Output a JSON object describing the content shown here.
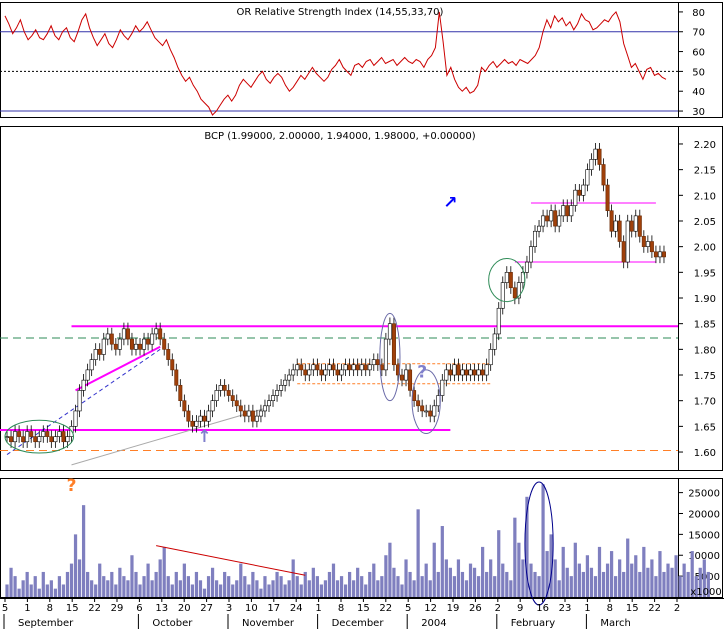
{
  "chart_data": [
    {
      "panel": "indicator",
      "type": "line",
      "title": "OR Relative Strength Index (14,55,33,70)",
      "yticks": [
        30,
        40,
        50,
        60,
        70,
        80
      ],
      "ylim": [
        27,
        85
      ],
      "guides": [
        {
          "y": 70,
          "style": "solid",
          "color": "#3333aa"
        },
        {
          "y": 50,
          "style": "dotted",
          "color": "#000000"
        },
        {
          "y": 30,
          "style": "solid",
          "color": "#3333aa"
        }
      ],
      "series": [
        {
          "color": "#cc0000",
          "values": [
            78,
            74,
            69,
            72,
            76,
            70,
            66,
            68,
            71,
            67,
            66,
            69,
            73,
            68,
            66,
            70,
            72,
            67,
            65,
            70,
            76,
            79,
            72,
            67,
            63,
            66,
            69,
            64,
            62,
            66,
            71,
            68,
            66,
            69,
            73,
            70,
            72,
            75,
            71,
            67,
            65,
            63,
            66,
            61,
            57,
            52,
            48,
            45,
            47,
            43,
            40,
            36,
            34,
            32,
            28,
            30,
            33,
            36,
            38,
            35,
            38,
            43,
            46,
            44,
            42,
            45,
            48,
            50,
            46,
            44,
            47,
            49,
            47,
            43,
            40,
            42,
            45,
            48,
            46,
            49,
            52,
            49,
            47,
            45,
            47,
            51,
            53,
            56,
            52,
            50,
            48,
            53,
            54,
            52,
            55,
            56,
            53,
            55,
            57,
            54,
            55,
            56,
            53,
            55,
            57,
            55,
            54,
            56,
            55,
            52,
            56,
            58,
            62,
            80,
            65,
            48,
            52,
            46,
            42,
            40,
            42,
            39,
            40,
            43,
            52,
            50,
            53,
            55,
            52,
            54,
            56,
            54,
            55,
            53,
            56,
            55,
            54,
            56,
            58,
            62,
            70,
            76,
            72,
            78,
            75,
            77,
            73,
            75,
            71,
            74,
            79,
            76,
            75,
            71,
            72,
            74,
            76,
            75,
            78,
            80,
            75,
            64,
            58,
            52,
            54,
            50,
            46,
            51,
            52,
            48,
            49,
            47,
            46
          ]
        }
      ]
    },
    {
      "panel": "price",
      "type": "candlestick",
      "title": "BCP (1.99000, 2.00000, 1.94000, 1.98000, +0.00000)",
      "yticks": [
        "1.60",
        "1.65",
        "1.70",
        "1.75",
        "1.80",
        "1.85",
        "1.90",
        "1.95",
        "2.00",
        "2.05",
        "2.10",
        "2.15",
        "2.20"
      ],
      "ylim": [
        1.565,
        2.235
      ],
      "close": [
        1.63,
        1.62,
        1.64,
        1.63,
        1.62,
        1.64,
        1.63,
        1.62,
        1.63,
        1.64,
        1.63,
        1.62,
        1.63,
        1.64,
        1.62,
        1.63,
        1.65,
        1.68,
        1.72,
        1.74,
        1.76,
        1.78,
        1.8,
        1.79,
        1.82,
        1.83,
        1.81,
        1.8,
        1.82,
        1.84,
        1.82,
        1.8,
        1.81,
        1.8,
        1.82,
        1.81,
        1.83,
        1.84,
        1.82,
        1.8,
        1.78,
        1.76,
        1.73,
        1.7,
        1.68,
        1.66,
        1.65,
        1.66,
        1.67,
        1.66,
        1.68,
        1.7,
        1.72,
        1.73,
        1.72,
        1.71,
        1.7,
        1.69,
        1.68,
        1.67,
        1.68,
        1.66,
        1.67,
        1.68,
        1.69,
        1.7,
        1.71,
        1.72,
        1.73,
        1.74,
        1.75,
        1.76,
        1.77,
        1.76,
        1.75,
        1.76,
        1.77,
        1.76,
        1.75,
        1.76,
        1.77,
        1.76,
        1.75,
        1.76,
        1.77,
        1.76,
        1.77,
        1.76,
        1.77,
        1.76,
        1.77,
        1.78,
        1.77,
        1.76,
        1.82,
        1.85,
        1.77,
        1.75,
        1.74,
        1.76,
        1.72,
        1.7,
        1.69,
        1.68,
        1.68,
        1.67,
        1.69,
        1.71,
        1.74,
        1.76,
        1.75,
        1.77,
        1.75,
        1.76,
        1.75,
        1.76,
        1.75,
        1.76,
        1.75,
        1.77,
        1.8,
        1.83,
        1.88,
        1.93,
        1.95,
        1.92,
        1.9,
        1.93,
        1.95,
        1.97,
        2.0,
        2.03,
        2.04,
        2.06,
        2.05,
        2.07,
        2.04,
        2.06,
        2.08,
        2.06,
        2.08,
        2.11,
        2.1,
        2.12,
        2.15,
        2.17,
        2.19,
        2.16,
        2.12,
        2.07,
        2.03,
        2.05,
        2.01,
        1.97,
        2.05,
        2.03,
        2.06,
        2.02,
        2.0,
        2.01,
        1.99,
        1.98,
        1.99,
        1.98
      ],
      "hlines": [
        {
          "y": 1.845,
          "color": "#ff00ff",
          "style": "solid",
          "width": 2,
          "x_from_index": 16,
          "x_to_index": 171
        },
        {
          "y": 1.643,
          "color": "#ff00ff",
          "style": "solid",
          "width": 2,
          "x_from_index": 0,
          "x_to_index": 110
        },
        {
          "y": 1.822,
          "color": "#2e8b57",
          "style": "dashed",
          "width": 1,
          "x_from_index": 0,
          "x_to_index": 174
        },
        {
          "y": 1.603,
          "color": "#ff7f27",
          "style": "dashed",
          "width": 1,
          "x_from_index": 0,
          "x_to_index": 174
        },
        {
          "y": 1.772,
          "color": "#ff7f27",
          "style": "dotted",
          "width": 1,
          "x_from_index": 72,
          "x_to_index": 120
        },
        {
          "y": 1.733,
          "color": "#ff7f27",
          "style": "dotted",
          "width": 1,
          "x_from_index": 72,
          "x_to_index": 120
        },
        {
          "y": 2.085,
          "color": "#ff00ff",
          "style": "solid",
          "width": 1,
          "x_from_index": 130,
          "x_to_index": 161
        },
        {
          "y": 1.97,
          "color": "#ff00ff",
          "style": "solid",
          "width": 1,
          "x_from_index": 126,
          "x_to_index": 161
        }
      ],
      "trendlines": [
        {
          "color": "#ff00ff",
          "width": 2,
          "from": [
            17,
            1.72
          ],
          "to": [
            38,
            1.805
          ]
        },
        {
          "color": "#3333cc",
          "width": 1,
          "style": "dashed",
          "from": [
            0,
            1.595
          ],
          "to": [
            38,
            1.8
          ]
        },
        {
          "color": "#aaaaaa",
          "width": 1,
          "style": "solid",
          "from": [
            16,
            1.575
          ],
          "to": [
            64,
            1.685
          ]
        }
      ],
      "ellipses": [
        {
          "color": "#2e8b57",
          "cx": 8,
          "cy": 1.63,
          "rx_bars": 8.5,
          "ry_price": 0.032
        },
        {
          "color": "#6a6aa8",
          "cx": 95,
          "cy": 1.785,
          "rx_bars": 2.5,
          "ry_price": 0.085
        },
        {
          "color": "#6a6aa8",
          "cx": 104,
          "cy": 1.698,
          "rx_bars": 3.5,
          "ry_price": 0.062
        },
        {
          "color": "#2e8b57",
          "cx": 124,
          "cy": 1.935,
          "rx_bars": 4.5,
          "ry_price": 0.042
        }
      ],
      "annotations": [
        {
          "text": "?",
          "color": "#8080cc",
          "at": [
            103,
            1.745
          ]
        },
        {
          "text": "↑",
          "color": "#8080cc",
          "at": [
            49,
            1.62
          ]
        },
        {
          "text": "↗",
          "color": "#0000ff",
          "at": [
            110,
            2.075
          ]
        }
      ]
    },
    {
      "panel": "volume",
      "type": "bar",
      "title": "x1000",
      "yticks": [
        5000,
        10000,
        15000,
        20000,
        25000
      ],
      "ylim": [
        0,
        28500
      ],
      "bar_color": "#7f7fbf",
      "values": [
        3000,
        7000,
        5000,
        2000,
        4000,
        6000,
        3000,
        5000,
        2000,
        6000,
        3000,
        4000,
        2000,
        5000,
        3000,
        6000,
        8000,
        15000,
        9000,
        22000,
        6000,
        4000,
        3000,
        8000,
        5000,
        4000,
        6000,
        3000,
        7000,
        5000,
        4000,
        10000,
        6000,
        3000,
        5000,
        8000,
        4000,
        6000,
        9000,
        12000,
        5000,
        3000,
        6000,
        4000,
        8000,
        5000,
        3000,
        6000,
        4000,
        2000,
        5000,
        7000,
        4000,
        3000,
        6000,
        5000,
        3000,
        4000,
        8000,
        5000,
        3000,
        6000,
        4000,
        2000,
        5000,
        3000,
        4000,
        6000,
        5000,
        3000,
        4000,
        9000,
        5000,
        3000,
        6000,
        4000,
        7000,
        5000,
        3000,
        4000,
        6000,
        8000,
        4000,
        5000,
        3000,
        6000,
        4000,
        7000,
        5000,
        3000,
        6000,
        8000,
        4000,
        5000,
        10000,
        13000,
        7000,
        5000,
        3000,
        9000,
        6000,
        4000,
        21000,
        5000,
        8000,
        4000,
        13000,
        6000,
        17000,
        9000,
        7000,
        5000,
        9000,
        6000,
        4000,
        8000,
        7000,
        5000,
        12000,
        6000,
        9000,
        5000,
        16000,
        8000,
        6000,
        4000,
        19000,
        13000,
        9000,
        24000,
        8000,
        6000,
        5000,
        27000,
        11000,
        15000,
        9000,
        4000,
        12000,
        7000,
        5000,
        13000,
        8000,
        6000,
        10000,
        7000,
        5000,
        12000,
        6000,
        8000,
        11000,
        5000,
        9000,
        6000,
        14000,
        8000,
        10000,
        6000,
        12000,
        7000,
        9000,
        5000,
        11000,
        6000,
        8000,
        7000,
        10000,
        5000,
        8000,
        6000,
        11000,
        5000,
        7000,
        9000,
        6000
      ],
      "trendline": {
        "color": "#cc0000",
        "from": [
          37,
          12300
        ],
        "to": [
          74,
          5200
        ]
      },
      "annotations": [
        {
          "text": "?",
          "color": "#ff7f27"
        }
      ],
      "ellipse": {
        "color": "#00008b",
        "cx": 132,
        "rx_bars": 3.5
      }
    }
  ],
  "x_axis": {
    "day_ticks": [
      "5",
      "1",
      "8",
      "15",
      "22",
      "29",
      "6",
      "13",
      "20",
      "27",
      "3",
      "10",
      "17",
      "24",
      "1",
      "8",
      "15",
      "22",
      "5",
      "12",
      "19",
      "26",
      "2",
      "9",
      "16",
      "23",
      "1",
      "8",
      "15",
      "22",
      "2"
    ],
    "month_labels": [
      "September",
      "October",
      "November",
      "December",
      "2004",
      "February",
      "March"
    ]
  }
}
